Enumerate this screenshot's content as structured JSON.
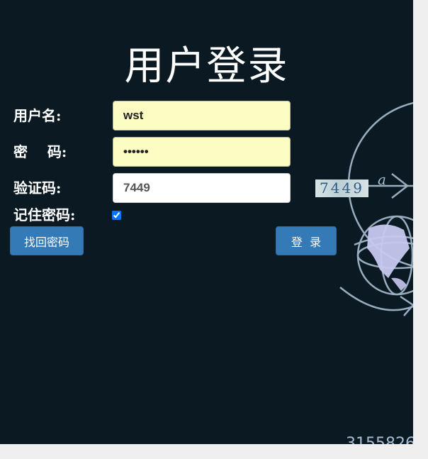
{
  "page": {
    "title": "用户登录"
  },
  "form": {
    "username": {
      "label": "用户名:",
      "value": "wst"
    },
    "password": {
      "label": "密    码:",
      "value": "wst123"
    },
    "captcha": {
      "label": "验证码:",
      "value": "7449",
      "image_text": "7449"
    },
    "remember": {
      "label": "记住密码:",
      "checked": true
    }
  },
  "buttons": {
    "recover": "找回密码",
    "login": "登  录"
  },
  "background_decoration": {
    "letter": "a",
    "number": "3155826"
  },
  "colors": {
    "panel_bg": "#0b1a22",
    "page_bg": "#efefef",
    "button": "#337ab7",
    "autofill": "#fbfdc2",
    "chalk": "#a9bdd2"
  }
}
